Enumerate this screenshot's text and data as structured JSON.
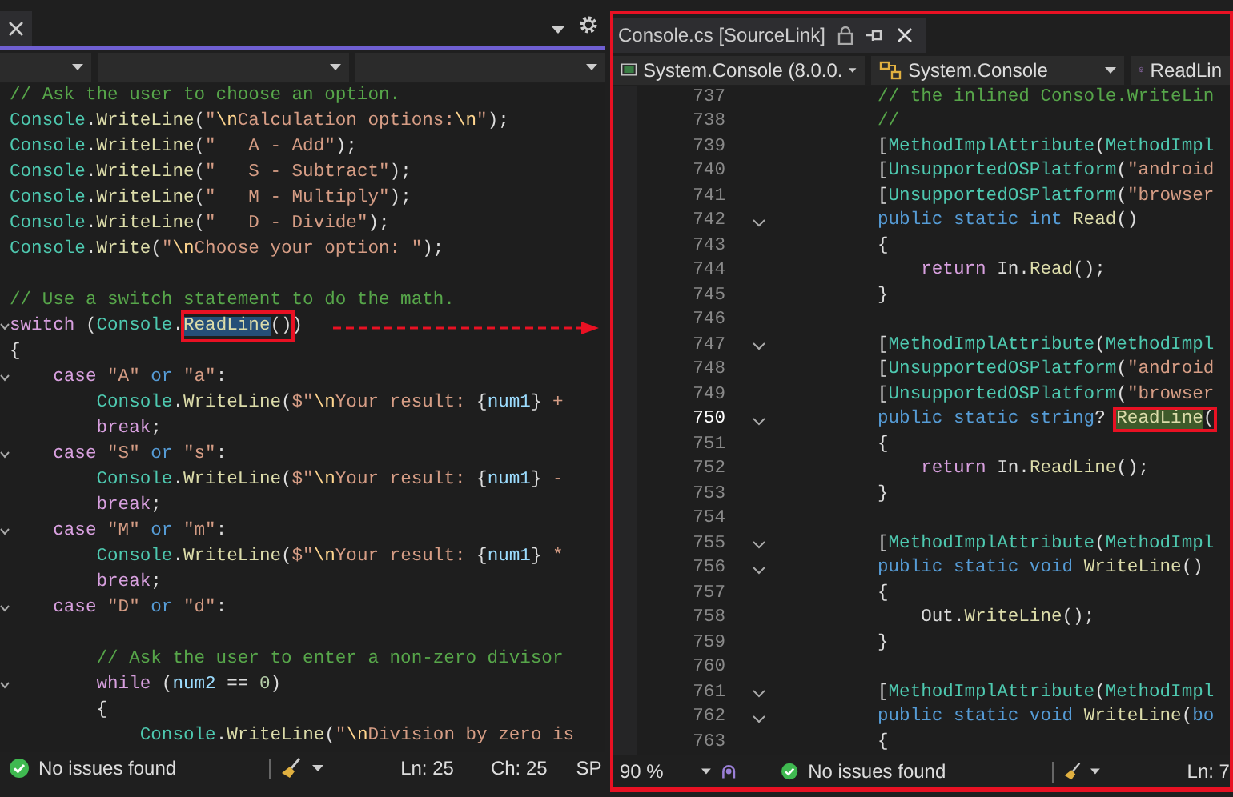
{
  "left_editor": {
    "lines": [
      {
        "fold": false,
        "segments": [
          {
            "kind": "comment",
            "text": "// Ask the user to choose an option."
          }
        ]
      },
      {
        "fold": false,
        "segments": [
          {
            "kind": "type",
            "text": "Console"
          },
          {
            "kind": "plain",
            "text": "."
          },
          {
            "kind": "method",
            "text": "WriteLine"
          },
          {
            "kind": "plain",
            "text": "("
          },
          {
            "kind": "string",
            "text": "\""
          },
          {
            "kind": "escape",
            "text": "\\n"
          },
          {
            "kind": "string",
            "text": "Calculation options:"
          },
          {
            "kind": "escape",
            "text": "\\n"
          },
          {
            "kind": "string",
            "text": "\""
          },
          {
            "kind": "plain",
            "text": ");"
          }
        ]
      },
      {
        "fold": false,
        "segments": [
          {
            "kind": "type",
            "text": "Console"
          },
          {
            "kind": "plain",
            "text": "."
          },
          {
            "kind": "method",
            "text": "WriteLine"
          },
          {
            "kind": "plain",
            "text": "("
          },
          {
            "kind": "string",
            "text": "\"   A - Add\""
          },
          {
            "kind": "plain",
            "text": ");"
          }
        ]
      },
      {
        "fold": false,
        "segments": [
          {
            "kind": "type",
            "text": "Console"
          },
          {
            "kind": "plain",
            "text": "."
          },
          {
            "kind": "method",
            "text": "WriteLine"
          },
          {
            "kind": "plain",
            "text": "("
          },
          {
            "kind": "string",
            "text": "\"   S - Subtract\""
          },
          {
            "kind": "plain",
            "text": ");"
          }
        ]
      },
      {
        "fold": false,
        "segments": [
          {
            "kind": "type",
            "text": "Console"
          },
          {
            "kind": "plain",
            "text": "."
          },
          {
            "kind": "method",
            "text": "WriteLine"
          },
          {
            "kind": "plain",
            "text": "("
          },
          {
            "kind": "string",
            "text": "\"   M - Multiply\""
          },
          {
            "kind": "plain",
            "text": ");"
          }
        ]
      },
      {
        "fold": false,
        "segments": [
          {
            "kind": "type",
            "text": "Console"
          },
          {
            "kind": "plain",
            "text": "."
          },
          {
            "kind": "method",
            "text": "WriteLine"
          },
          {
            "kind": "plain",
            "text": "("
          },
          {
            "kind": "string",
            "text": "\"   D - Divide\""
          },
          {
            "kind": "plain",
            "text": ");"
          }
        ]
      },
      {
        "fold": false,
        "segments": [
          {
            "kind": "type",
            "text": "Console"
          },
          {
            "kind": "plain",
            "text": "."
          },
          {
            "kind": "method",
            "text": "Write"
          },
          {
            "kind": "plain",
            "text": "("
          },
          {
            "kind": "string",
            "text": "\""
          },
          {
            "kind": "escape",
            "text": "\\n"
          },
          {
            "kind": "string",
            "text": "Choose your option: \""
          },
          {
            "kind": "plain",
            "text": ");"
          }
        ]
      },
      {
        "fold": false
      },
      {
        "fold": false,
        "segments": [
          {
            "kind": "comment",
            "text": "// Use a switch statement to do the math."
          }
        ]
      },
      {
        "fold": true,
        "segments": [
          {
            "kind": "control",
            "text": "switch"
          },
          {
            "kind": "plain",
            "text": " ("
          },
          {
            "kind": "type",
            "text": "Console"
          },
          {
            "kind": "plain",
            "text": "."
          },
          {
            "kind": "callout",
            "selected": true,
            "referenced": false,
            "parts": [
              {
                "kind": "method",
                "text": "ReadLine"
              },
              {
                "kind": "plain",
                "text": "()"
              }
            ]
          },
          {
            "kind": "plain",
            "text": ")"
          }
        ]
      },
      {
        "fold": false,
        "segments": [
          {
            "kind": "plain",
            "text": "{"
          }
        ]
      },
      {
        "fold": true,
        "segments": [
          {
            "kind": "control",
            "text": "    case"
          },
          {
            "kind": "string",
            "text": " \"A\" "
          },
          {
            "kind": "keyword",
            "text": "or"
          },
          {
            "kind": "string",
            "text": " \"a\""
          },
          {
            "kind": "plain",
            "text": ":"
          }
        ]
      },
      {
        "fold": false,
        "segments": [
          {
            "kind": "type",
            "text": "        Console"
          },
          {
            "kind": "plain",
            "text": "."
          },
          {
            "kind": "method",
            "text": "WriteLine"
          },
          {
            "kind": "plain",
            "text": "("
          },
          {
            "kind": "string",
            "text": "$\""
          },
          {
            "kind": "escape",
            "text": "\\n"
          },
          {
            "kind": "string",
            "text": "Your result: "
          },
          {
            "kind": "plain",
            "text": "{"
          },
          {
            "kind": "param",
            "text": "num1"
          },
          {
            "kind": "plain",
            "text": "}"
          },
          {
            "kind": "string",
            "text": " +"
          }
        ]
      },
      {
        "fold": false,
        "segments": [
          {
            "kind": "control",
            "text": "        break"
          },
          {
            "kind": "plain",
            "text": ";"
          }
        ]
      },
      {
        "fold": true,
        "segments": [
          {
            "kind": "control",
            "text": "    case"
          },
          {
            "kind": "string",
            "text": " \"S\" "
          },
          {
            "kind": "keyword",
            "text": "or"
          },
          {
            "kind": "string",
            "text": " \"s\""
          },
          {
            "kind": "plain",
            "text": ":"
          }
        ]
      },
      {
        "fold": false,
        "segments": [
          {
            "kind": "type",
            "text": "        Console"
          },
          {
            "kind": "plain",
            "text": "."
          },
          {
            "kind": "method",
            "text": "WriteLine"
          },
          {
            "kind": "plain",
            "text": "("
          },
          {
            "kind": "string",
            "text": "$\""
          },
          {
            "kind": "escape",
            "text": "\\n"
          },
          {
            "kind": "string",
            "text": "Your result: "
          },
          {
            "kind": "plain",
            "text": "{"
          },
          {
            "kind": "param",
            "text": "num1"
          },
          {
            "kind": "plain",
            "text": "}"
          },
          {
            "kind": "string",
            "text": " -"
          }
        ]
      },
      {
        "fold": false,
        "segments": [
          {
            "kind": "control",
            "text": "        break"
          },
          {
            "kind": "plain",
            "text": ";"
          }
        ]
      },
      {
        "fold": true,
        "segments": [
          {
            "kind": "control",
            "text": "    case"
          },
          {
            "kind": "string",
            "text": " \"M\" "
          },
          {
            "kind": "keyword",
            "text": "or"
          },
          {
            "kind": "string",
            "text": " \"m\""
          },
          {
            "kind": "plain",
            "text": ":"
          }
        ]
      },
      {
        "fold": false,
        "segments": [
          {
            "kind": "type",
            "text": "        Console"
          },
          {
            "kind": "plain",
            "text": "."
          },
          {
            "kind": "method",
            "text": "WriteLine"
          },
          {
            "kind": "plain",
            "text": "("
          },
          {
            "kind": "string",
            "text": "$\""
          },
          {
            "kind": "escape",
            "text": "\\n"
          },
          {
            "kind": "string",
            "text": "Your result: "
          },
          {
            "kind": "plain",
            "text": "{"
          },
          {
            "kind": "param",
            "text": "num1"
          },
          {
            "kind": "plain",
            "text": "}"
          },
          {
            "kind": "string",
            "text": " *"
          }
        ]
      },
      {
        "fold": false,
        "segments": [
          {
            "kind": "control",
            "text": "        break"
          },
          {
            "kind": "plain",
            "text": ";"
          }
        ]
      },
      {
        "fold": true,
        "segments": [
          {
            "kind": "control",
            "text": "    case"
          },
          {
            "kind": "string",
            "text": " \"D\" "
          },
          {
            "kind": "keyword",
            "text": "or"
          },
          {
            "kind": "string",
            "text": " \"d\""
          },
          {
            "kind": "plain",
            "text": ":"
          }
        ]
      },
      {
        "fold": false
      },
      {
        "fold": false,
        "segments": [
          {
            "kind": "comment",
            "text": "        // Ask the user to enter a non-zero divisor"
          }
        ]
      },
      {
        "fold": true,
        "segments": [
          {
            "kind": "control",
            "text": "        while"
          },
          {
            "kind": "plain",
            "text": " ("
          },
          {
            "kind": "param",
            "text": "num2"
          },
          {
            "kind": "plain",
            "text": " == "
          },
          {
            "kind": "number",
            "text": "0"
          },
          {
            "kind": "plain",
            "text": ")"
          }
        ]
      },
      {
        "fold": false,
        "segments": [
          {
            "kind": "plain",
            "text": "        {"
          }
        ]
      },
      {
        "fold": false,
        "segments": [
          {
            "kind": "type",
            "text": "            Console"
          },
          {
            "kind": "plain",
            "text": "."
          },
          {
            "kind": "method",
            "text": "WriteLine"
          },
          {
            "kind": "plain",
            "text": "("
          },
          {
            "kind": "string",
            "text": "\""
          },
          {
            "kind": "escape",
            "text": "\\n"
          },
          {
            "kind": "string",
            "text": "Division by zero is"
          }
        ]
      }
    ],
    "status_bar": {
      "issues": "No issues found",
      "line": "Ln: 25",
      "column": "Ch: 25",
      "mode": "SP"
    }
  },
  "right_editor": {
    "tab": {
      "title": "Console.cs [SourceLink]"
    },
    "nav": {
      "project": "System.Console (8.0.0.",
      "type": "System.Console",
      "member": "ReadLin"
    },
    "lines": [
      {
        "number": "737",
        "fold": false,
        "current": false,
        "segments": [
          {
            "kind": "comment",
            "text": "// the inlined Console.WriteLin"
          }
        ]
      },
      {
        "number": "738",
        "fold": false,
        "current": false,
        "segments": [
          {
            "kind": "comment",
            "text": "//"
          }
        ]
      },
      {
        "number": "739",
        "fold": false,
        "current": false,
        "segments": [
          {
            "kind": "plain",
            "text": "["
          },
          {
            "kind": "type",
            "text": "MethodImplAttribute"
          },
          {
            "kind": "plain",
            "text": "("
          },
          {
            "kind": "type",
            "text": "MethodImpl"
          }
        ]
      },
      {
        "number": "740",
        "fold": false,
        "current": false,
        "segments": [
          {
            "kind": "plain",
            "text": "["
          },
          {
            "kind": "type",
            "text": "UnsupportedOSPlatform"
          },
          {
            "kind": "plain",
            "text": "("
          },
          {
            "kind": "string",
            "text": "\"android"
          }
        ]
      },
      {
        "number": "741",
        "fold": false,
        "current": false,
        "segments": [
          {
            "kind": "plain",
            "text": "["
          },
          {
            "kind": "type",
            "text": "UnsupportedOSPlatform"
          },
          {
            "kind": "plain",
            "text": "("
          },
          {
            "kind": "string",
            "text": "\"browser"
          }
        ]
      },
      {
        "number": "742",
        "fold": true,
        "current": false,
        "segments": [
          {
            "kind": "keyword",
            "text": "public static int "
          },
          {
            "kind": "method",
            "text": "Read"
          },
          {
            "kind": "plain",
            "text": "()"
          }
        ]
      },
      {
        "number": "743",
        "fold": false,
        "current": false,
        "segments": [
          {
            "kind": "plain",
            "text": "{"
          }
        ]
      },
      {
        "number": "744",
        "fold": false,
        "current": false,
        "segments": [
          {
            "kind": "control",
            "text": "    return"
          },
          {
            "kind": "plain",
            "text": " In."
          },
          {
            "kind": "method",
            "text": "Read"
          },
          {
            "kind": "plain",
            "text": "();"
          }
        ]
      },
      {
        "number": "745",
        "fold": false,
        "current": false,
        "segments": [
          {
            "kind": "plain",
            "text": "}"
          }
        ]
      },
      {
        "number": "746",
        "fold": false,
        "current": false
      },
      {
        "number": "747",
        "fold": true,
        "current": false,
        "segments": [
          {
            "kind": "plain",
            "text": "["
          },
          {
            "kind": "type",
            "text": "MethodImplAttribute"
          },
          {
            "kind": "plain",
            "text": "("
          },
          {
            "kind": "type",
            "text": "MethodImpl"
          }
        ]
      },
      {
        "number": "748",
        "fold": false,
        "current": false,
        "segments": [
          {
            "kind": "plain",
            "text": "["
          },
          {
            "kind": "type",
            "text": "UnsupportedOSPlatform"
          },
          {
            "kind": "plain",
            "text": "("
          },
          {
            "kind": "string",
            "text": "\"android"
          }
        ]
      },
      {
        "number": "749",
        "fold": false,
        "current": false,
        "segments": [
          {
            "kind": "plain",
            "text": "["
          },
          {
            "kind": "type",
            "text": "UnsupportedOSPlatform"
          },
          {
            "kind": "plain",
            "text": "("
          },
          {
            "kind": "string",
            "text": "\"browser"
          }
        ]
      },
      {
        "number": "750",
        "fold": true,
        "current": true,
        "segments": [
          {
            "kind": "keyword",
            "text": "public static string"
          },
          {
            "kind": "plain",
            "text": "? "
          },
          {
            "kind": "callout",
            "selected": false,
            "referenced": true,
            "parts": [
              {
                "kind": "method",
                "text": "ReadLine"
              },
              {
                "kind": "plain",
                "text": "("
              }
            ]
          }
        ]
      },
      {
        "number": "751",
        "fold": false,
        "current": false,
        "segments": [
          {
            "kind": "plain",
            "text": "{"
          }
        ]
      },
      {
        "number": "752",
        "fold": false,
        "current": false,
        "segments": [
          {
            "kind": "control",
            "text": "    return"
          },
          {
            "kind": "plain",
            "text": " In."
          },
          {
            "kind": "method",
            "text": "ReadLine"
          },
          {
            "kind": "plain",
            "text": "();"
          }
        ]
      },
      {
        "number": "753",
        "fold": false,
        "current": false,
        "segments": [
          {
            "kind": "plain",
            "text": "}"
          }
        ]
      },
      {
        "number": "754",
        "fold": false,
        "current": false
      },
      {
        "number": "755",
        "fold": true,
        "current": false,
        "segments": [
          {
            "kind": "plain",
            "text": "["
          },
          {
            "kind": "type",
            "text": "MethodImplAttribute"
          },
          {
            "kind": "plain",
            "text": "("
          },
          {
            "kind": "type",
            "text": "MethodImpl"
          }
        ]
      },
      {
        "number": "756",
        "fold": true,
        "current": false,
        "segments": [
          {
            "kind": "keyword",
            "text": "public static void "
          },
          {
            "kind": "method",
            "text": "WriteLine"
          },
          {
            "kind": "plain",
            "text": "()"
          }
        ]
      },
      {
        "number": "757",
        "fold": false,
        "current": false,
        "segments": [
          {
            "kind": "plain",
            "text": "{"
          }
        ]
      },
      {
        "number": "758",
        "fold": false,
        "current": false,
        "segments": [
          {
            "kind": "plain",
            "text": "    Out."
          },
          {
            "kind": "method",
            "text": "WriteLine"
          },
          {
            "kind": "plain",
            "text": "();"
          }
        ]
      },
      {
        "number": "759",
        "fold": false,
        "current": false,
        "segments": [
          {
            "kind": "plain",
            "text": "}"
          }
        ]
      },
      {
        "number": "760",
        "fold": false,
        "current": false
      },
      {
        "number": "761",
        "fold": true,
        "current": false,
        "segments": [
          {
            "kind": "plain",
            "text": "["
          },
          {
            "kind": "type",
            "text": "MethodImplAttribute"
          },
          {
            "kind": "plain",
            "text": "("
          },
          {
            "kind": "type",
            "text": "MethodImpl"
          }
        ]
      },
      {
        "number": "762",
        "fold": true,
        "current": false,
        "segments": [
          {
            "kind": "keyword",
            "text": "public static void "
          },
          {
            "kind": "method",
            "text": "WriteLine"
          },
          {
            "kind": "plain",
            "text": "("
          },
          {
            "kind": "keyword",
            "text": "bo"
          }
        ]
      },
      {
        "number": "763",
        "fold": false,
        "current": false,
        "segments": [
          {
            "kind": "plain",
            "text": "{"
          }
        ]
      }
    ],
    "status_bar": {
      "zoom": "90 %",
      "issues": "No issues found",
      "line": "Ln: 7"
    }
  }
}
